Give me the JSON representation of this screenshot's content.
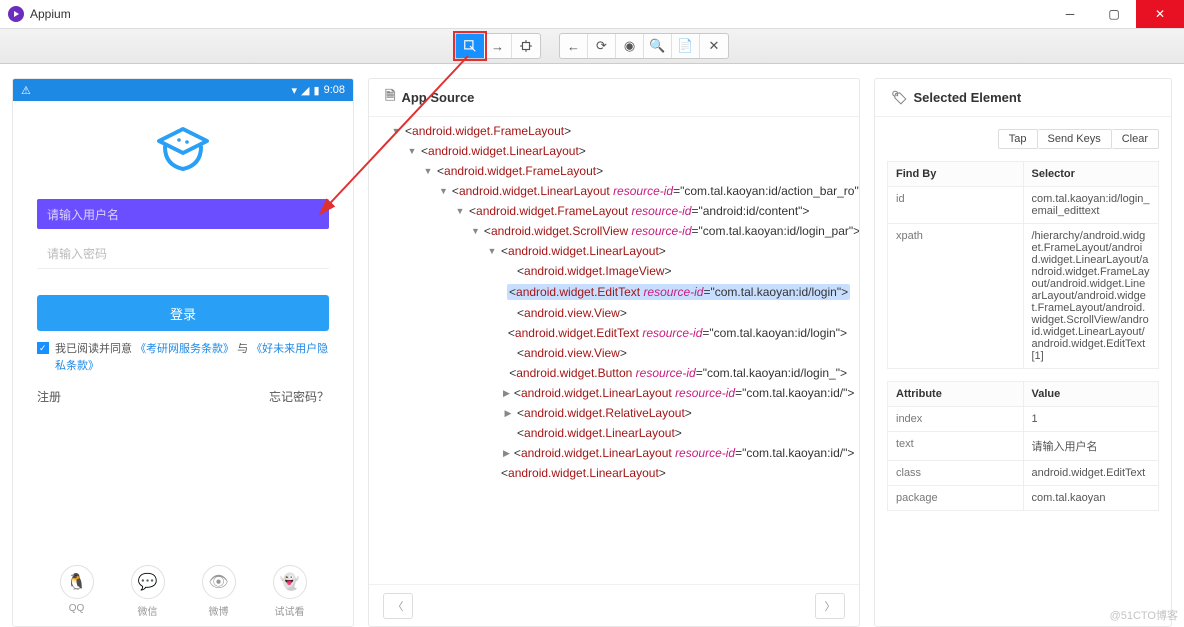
{
  "window": {
    "title": "Appium"
  },
  "phone": {
    "time": "9:08",
    "username_placeholder": "请输入用户名",
    "password_placeholder": "请输入密码",
    "login_label": "登录",
    "agree_prefix": "我已阅读并同意",
    "terms1": "《考研网服务条款》",
    "and": "与",
    "terms2": "《好未来用户隐私条款》",
    "register": "注册",
    "forgot": "忘记密码？",
    "social": [
      "QQ",
      "微信",
      "微博",
      "试试看"
    ]
  },
  "source": {
    "heading": "App Source",
    "rows": [
      {
        "indent": 0,
        "caret": "▼",
        "tag": "android.widget.FrameLayout"
      },
      {
        "indent": 1,
        "caret": "▼",
        "tag": "android.widget.LinearLayout"
      },
      {
        "indent": 2,
        "caret": "▼",
        "tag": "android.widget.FrameLayout"
      },
      {
        "indent": 3,
        "caret": "▼",
        "tag": "android.widget.LinearLayout",
        "rid": "com.tal.kaoyan:id/action_bar_ro"
      },
      {
        "indent": 4,
        "caret": "▼",
        "tag": "android.widget.FrameLayout",
        "rid": "android:id/content"
      },
      {
        "indent": 5,
        "caret": "▼",
        "tag": "android.widget.ScrollView",
        "rid": "com.tal.kaoyan:id/login_par"
      },
      {
        "indent": 6,
        "caret": "▼",
        "tag": "android.widget.LinearLayout"
      },
      {
        "indent": 7,
        "caret": "",
        "tag": "android.widget.ImageView"
      },
      {
        "indent": 7,
        "caret": "",
        "tag": "android.widget.EditText",
        "rid": "com.tal.kaoyan:id/login",
        "hl": true
      },
      {
        "indent": 7,
        "caret": "",
        "tag": "android.view.View"
      },
      {
        "indent": 7,
        "caret": "",
        "tag": "android.widget.EditText",
        "rid": "com.tal.kaoyan:id/login"
      },
      {
        "indent": 7,
        "caret": "",
        "tag": "android.view.View"
      },
      {
        "indent": 7,
        "caret": "",
        "tag": "android.widget.Button",
        "rid": "com.tal.kaoyan:id/login_"
      },
      {
        "indent": 7,
        "caret": "▶",
        "tag": "android.widget.LinearLayout",
        "rid": "com.tal.kaoyan:id/"
      },
      {
        "indent": 7,
        "caret": "▶",
        "tag": "android.widget.RelativeLayout"
      },
      {
        "indent": 7,
        "caret": "",
        "tag": "android.widget.LinearLayout"
      },
      {
        "indent": 7,
        "caret": "▶",
        "tag": "android.widget.LinearLayout",
        "rid": "com.tal.kaoyan:id/"
      },
      {
        "indent": 6,
        "caret": "",
        "tag": "android.widget.LinearLayout"
      }
    ]
  },
  "selected": {
    "heading": "Selected Element",
    "buttons": [
      "Tap",
      "Send Keys",
      "Clear"
    ],
    "findby_header": [
      "Find By",
      "Selector"
    ],
    "findby": [
      {
        "k": "id",
        "v": "com.tal.kaoyan:id/login_email_edittext"
      },
      {
        "k": "xpath",
        "v": "/hierarchy/android.widget.FrameLayout/android.widget.LinearLayout/android.widget.FrameLayout/android.widget.LinearLayout/android.widget.FrameLayout/android.widget.ScrollView/android.widget.LinearLayout/android.widget.EditText[1]"
      }
    ],
    "attr_header": [
      "Attribute",
      "Value"
    ],
    "attrs": [
      {
        "k": "index",
        "v": "1"
      },
      {
        "k": "text",
        "v": "请输入用户名"
      },
      {
        "k": "class",
        "v": "android.widget.EditText"
      },
      {
        "k": "package",
        "v": "com.tal.kaoyan"
      }
    ]
  },
  "watermark": "@51CTO博客"
}
